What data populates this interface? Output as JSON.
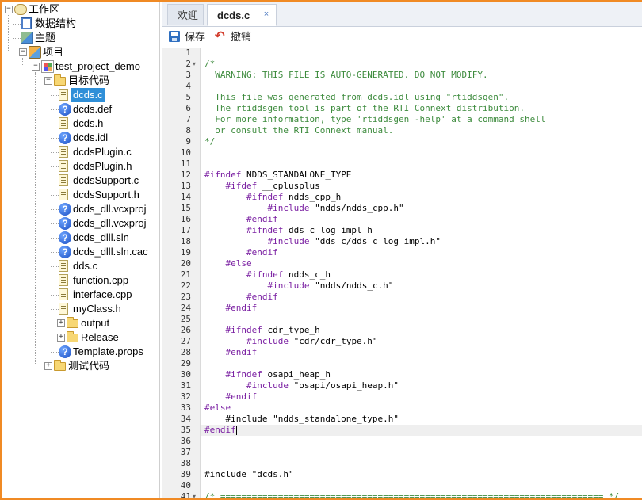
{
  "tree": [
    {
      "label": "工作区",
      "level": 0,
      "icon": "workspace-icon",
      "expander": "minus",
      "name": "tree-workspace"
    },
    {
      "label": "数据结构",
      "level": 1,
      "icon": "book-icon",
      "expander": null,
      "name": "tree-data-structures"
    },
    {
      "label": "主题",
      "level": 1,
      "icon": "topic-icon",
      "expander": null,
      "name": "tree-topics"
    },
    {
      "label": "项目",
      "level": 1,
      "icon": "project-icon",
      "expander": "minus",
      "name": "tree-projects"
    },
    {
      "label": "test_project_demo",
      "level": 2,
      "icon": "project-tree-icon",
      "expander": "minus",
      "name": "tree-test-project-demo"
    },
    {
      "label": "目标代码",
      "level": 3,
      "icon": "folder-icon",
      "expander": "minus",
      "name": "tree-target-code"
    },
    {
      "label": "dcds.c",
      "level": 4,
      "icon": "file-icon",
      "expander": null,
      "selected": true,
      "name": "tree-file-dcds-c"
    },
    {
      "label": "dcds.def",
      "level": 4,
      "icon": "unknown-file-icon",
      "expander": null,
      "name": "tree-file-dcds-def"
    },
    {
      "label": "dcds.h",
      "level": 4,
      "icon": "file-icon",
      "expander": null,
      "name": "tree-file-dcds-h"
    },
    {
      "label": "dcds.idl",
      "level": 4,
      "icon": "unknown-file-icon",
      "expander": null,
      "name": "tree-file-dcds-idl"
    },
    {
      "label": "dcdsPlugin.c",
      "level": 4,
      "icon": "file-icon",
      "expander": null,
      "name": "tree-file-dcdsplugin-c"
    },
    {
      "label": "dcdsPlugin.h",
      "level": 4,
      "icon": "file-icon",
      "expander": null,
      "name": "tree-file-dcdsplugin-h"
    },
    {
      "label": "dcdsSupport.c",
      "level": 4,
      "icon": "file-icon",
      "expander": null,
      "name": "tree-file-dcdssupport-c"
    },
    {
      "label": "dcdsSupport.h",
      "level": 4,
      "icon": "file-icon",
      "expander": null,
      "name": "tree-file-dcdssupport-h"
    },
    {
      "label": "dcds_dll.vcxproj",
      "level": 4,
      "icon": "unknown-file-icon",
      "expander": null,
      "name": "tree-file-dcds-dll-vcxproj"
    },
    {
      "label": "dcds_dll.vcxproj",
      "level": 4,
      "icon": "unknown-file-icon",
      "expander": null,
      "name": "tree-file-dcds-dll-vcxproj-2"
    },
    {
      "label": "dcds_dlll.sln",
      "level": 4,
      "icon": "unknown-file-icon",
      "expander": null,
      "name": "tree-file-dcds-dlll-sln"
    },
    {
      "label": "dcds_dlll.sln.cac",
      "level": 4,
      "icon": "unknown-file-icon",
      "expander": null,
      "name": "tree-file-dcds-dlll-sln-cache"
    },
    {
      "label": "dds.c",
      "level": 4,
      "icon": "file-icon",
      "expander": null,
      "name": "tree-file-dds-c"
    },
    {
      "label": "function.cpp",
      "level": 4,
      "icon": "file-icon",
      "expander": null,
      "name": "tree-file-function-cpp"
    },
    {
      "label": "interface.cpp",
      "level": 4,
      "icon": "file-icon",
      "expander": null,
      "name": "tree-file-interface-cpp"
    },
    {
      "label": "myClass.h",
      "level": 4,
      "icon": "file-icon",
      "expander": null,
      "name": "tree-file-myclass-h"
    },
    {
      "label": "output",
      "level": 4,
      "icon": "folder-icon",
      "expander": "plus",
      "name": "tree-folder-output"
    },
    {
      "label": "Release",
      "level": 4,
      "icon": "folder-icon",
      "expander": "plus",
      "name": "tree-folder-release"
    },
    {
      "label": "Template.props",
      "level": 4,
      "icon": "unknown-file-icon",
      "expander": null,
      "name": "tree-file-template-props"
    },
    {
      "label": "测试代码",
      "level": 3,
      "icon": "folder-icon",
      "expander": "plus",
      "name": "tree-test-code"
    }
  ],
  "tabs": {
    "welcome": "欢迎",
    "active": "dcds.c",
    "close": "×"
  },
  "toolbar": {
    "save": "保存",
    "undo": "撤销"
  },
  "editor": {
    "current_line": 35,
    "lines": [
      {
        "n": "1",
        "text": "",
        "fold": ""
      },
      {
        "n": "2",
        "text": "/*",
        "fold": "▾",
        "cls": "cmt"
      },
      {
        "n": "3",
        "text": "  WARNING: THIS FILE IS AUTO-GENERATED. DO NOT MODIFY.",
        "fold": "",
        "cls": "cmt"
      },
      {
        "n": "4",
        "text": "",
        "fold": "",
        "cls": "cmt"
      },
      {
        "n": "5",
        "text": "  This file was generated from dcds.idl using \"rtiddsgen\".",
        "fold": "",
        "cls": "cmt"
      },
      {
        "n": "6",
        "text": "  The rtiddsgen tool is part of the RTI Connext distribution.",
        "fold": "",
        "cls": "cmt"
      },
      {
        "n": "7",
        "text": "  For more information, type 'rtiddsgen -help' at a command shell",
        "fold": "",
        "cls": "cmt"
      },
      {
        "n": "8",
        "text": "  or consult the RTI Connext manual.",
        "fold": "",
        "cls": "cmt"
      },
      {
        "n": "9",
        "text": "*/",
        "fold": "",
        "cls": "cmt"
      },
      {
        "n": "10",
        "text": "",
        "fold": ""
      },
      {
        "n": "11",
        "text": "",
        "fold": ""
      },
      {
        "n": "12",
        "text": "#ifndef NDDS_STANDALONE_TYPE",
        "fold": "",
        "pp": true
      },
      {
        "n": "13",
        "text": "    #ifdef __cplusplus",
        "fold": "",
        "pp": true
      },
      {
        "n": "14",
        "text": "        #ifndef ndds_cpp_h",
        "fold": "",
        "pp": true
      },
      {
        "n": "15",
        "text": "            #include \"ndds/ndds_cpp.h\"",
        "fold": "",
        "pp": true
      },
      {
        "n": "16",
        "text": "        #endif",
        "fold": "",
        "pp": true
      },
      {
        "n": "17",
        "text": "        #ifndef dds_c_log_impl_h",
        "fold": "",
        "pp": true
      },
      {
        "n": "18",
        "text": "            #include \"dds_c/dds_c_log_impl.h\"",
        "fold": "",
        "pp": true
      },
      {
        "n": "19",
        "text": "        #endif",
        "fold": "",
        "pp": true
      },
      {
        "n": "20",
        "text": "    #else",
        "fold": "",
        "pp": true
      },
      {
        "n": "21",
        "text": "        #ifndef ndds_c_h",
        "fold": "",
        "pp": true
      },
      {
        "n": "22",
        "text": "            #include \"ndds/ndds_c.h\"",
        "fold": "",
        "pp": true
      },
      {
        "n": "23",
        "text": "        #endif",
        "fold": "",
        "pp": true
      },
      {
        "n": "24",
        "text": "    #endif",
        "fold": "",
        "pp": true
      },
      {
        "n": "25",
        "text": "",
        "fold": ""
      },
      {
        "n": "26",
        "text": "    #ifndef cdr_type_h",
        "fold": "",
        "pp": true
      },
      {
        "n": "27",
        "text": "        #include \"cdr/cdr_type.h\"",
        "fold": "",
        "pp": true
      },
      {
        "n": "28",
        "text": "    #endif",
        "fold": "",
        "pp": true
      },
      {
        "n": "29",
        "text": "",
        "fold": ""
      },
      {
        "n": "30",
        "text": "    #ifndef osapi_heap_h",
        "fold": "",
        "pp": true
      },
      {
        "n": "31",
        "text": "        #include \"osapi/osapi_heap.h\"",
        "fold": "",
        "pp": true
      },
      {
        "n": "32",
        "text": "    #endif",
        "fold": "",
        "pp": true
      },
      {
        "n": "33",
        "text": "#else",
        "fold": "",
        "pp": true
      },
      {
        "n": "34",
        "text": "    #include \"ndds_standalone_type.h\"",
        "fold": "",
        "pp": false
      },
      {
        "n": "35",
        "text": "#endif",
        "fold": "",
        "pp": true
      },
      {
        "n": "36",
        "text": "",
        "fold": ""
      },
      {
        "n": "37",
        "text": "",
        "fold": ""
      },
      {
        "n": "38",
        "text": "",
        "fold": ""
      },
      {
        "n": "39",
        "text": "#include \"dcds.h\"",
        "fold": "",
        "pp": false
      },
      {
        "n": "40",
        "text": "",
        "fold": ""
      },
      {
        "n": "41",
        "text": "/* ========================================================================= */",
        "fold": "▾",
        "cls": "cmt"
      }
    ]
  }
}
